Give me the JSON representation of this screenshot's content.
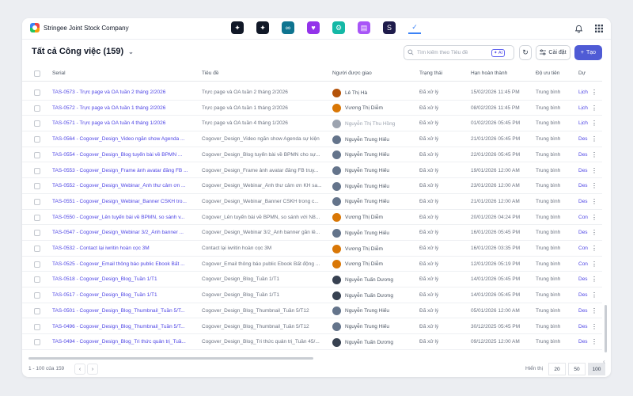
{
  "brand": {
    "name": "Stringee Joint Stock Company"
  },
  "apps": [
    {
      "icon": "grid-app-icon",
      "color": "#111827",
      "glyph": "✦"
    },
    {
      "icon": "grid-app-icon",
      "color": "#111827",
      "glyph": "✦"
    },
    {
      "icon": "link-app-icon",
      "color": "#0e7490",
      "glyph": "∞"
    },
    {
      "icon": "heart-app-icon",
      "color": "#9333ea",
      "glyph": "♥"
    },
    {
      "icon": "gear-app-icon",
      "color": "#14b8a6",
      "glyph": "⚙"
    },
    {
      "icon": "chat-app-icon",
      "color": "#a855f7",
      "glyph": "▤"
    },
    {
      "icon": "s-app-icon",
      "color": "#1e1b4b",
      "glyph": "S"
    },
    {
      "icon": "check-app-icon",
      "color": "#3b82f6",
      "glyph": "✓",
      "active": true
    }
  ],
  "header": {
    "title": "Tất cả Công việc (159)",
    "search_placeholder": "Tìm kiếm theo Tiêu đề",
    "ai_label": "AI",
    "settings_label": "Cài đặt",
    "create_label": "Tạo"
  },
  "columns": {
    "serial": "Serial",
    "title": "Tiêu đề",
    "assignee": "Người được giao",
    "status": "Trạng thái",
    "due": "Hạn hoàn thành",
    "priority": "Độ ưu tiên",
    "project": "Dự"
  },
  "rows": [
    {
      "serial": "TAS-0573 - Trực page và OA tuần 2 tháng 2/2026",
      "title": "Trực page và OA tuần 2 tháng 2/2026",
      "assignee": "Lê Thị Hà",
      "avatar": "#b45309",
      "faded": false,
      "status": "Đã xử lý",
      "due": "15/02/2026 11:45 PM",
      "priority": "Trung bình",
      "project": "Lịch"
    },
    {
      "serial": "TAS-0572 - Trực page và OA tuần 1 tháng 2/2026",
      "title": "Trực page và OA tuần 1 tháng 2/2026",
      "assignee": "Vương Thị Diễm",
      "avatar": "#d97706",
      "faded": false,
      "status": "Đã xử lý",
      "due": "08/02/2026 11:45 PM",
      "priority": "Trung bình",
      "project": "Lịch"
    },
    {
      "serial": "TAS-0571 - Trực page và OA tuần 4 tháng 1/2026",
      "title": "Trực page và OA tuần 4 tháng 1/2026",
      "assignee": "Nguyễn Thị Thu Hồng",
      "avatar": "#9ca3af",
      "faded": true,
      "status": "Đã xử lý",
      "due": "01/02/2026 05:45 PM",
      "priority": "Trung bình",
      "project": "Lịch"
    },
    {
      "serial": "TAS-0564 - Cogover_Design_Video ngắn show Agenda ...",
      "title": "Cogover_Design_Video ngắn show Agenda sự kiện",
      "assignee": "Nguyễn Trung Hiếu",
      "avatar": "#64748b",
      "faded": false,
      "status": "Đã xử lý",
      "due": "21/01/2026 05:45 PM",
      "priority": "Trung bình",
      "project": "Des"
    },
    {
      "serial": "TAS-0554 - Cogover_Design_Blog tuyển bài về BPMN ...",
      "title": "Cogover_Design_Blog tuyển bài về BPMN cho sự...",
      "assignee": "Nguyễn Trung Hiếu",
      "avatar": "#64748b",
      "faded": false,
      "status": "Đã xử lý",
      "due": "22/01/2026 05:45 PM",
      "priority": "Trung bình",
      "project": "Des"
    },
    {
      "serial": "TAS-0553 - Cogover_Design_Frame ảnh avatar đăng FB ...",
      "title": "Cogover_Design_Frame ảnh avatar đăng FB truy...",
      "assignee": "Nguyễn Trung Hiếu",
      "avatar": "#64748b",
      "faded": false,
      "status": "Đã xử lý",
      "due": "19/01/2026 12:00 AM",
      "priority": "Trung bình",
      "project": "Des"
    },
    {
      "serial": "TAS-0552 - Cogover_Design_Webinar_Ảnh thư cảm ơn ...",
      "title": "Cogover_Design_Webinar_Ảnh thư cảm ơn KH sa...",
      "assignee": "Nguyễn Trung Hiếu",
      "avatar": "#64748b",
      "faded": false,
      "status": "Đã xử lý",
      "due": "23/01/2026 12:00 AM",
      "priority": "Trung bình",
      "project": "Des"
    },
    {
      "serial": "TAS-0551 - Cogover_Design_Webinar_Banner CSKH tro...",
      "title": "Cogover_Design_Webinar_Banner CSKH trong c...",
      "assignee": "Nguyễn Trung Hiếu",
      "avatar": "#64748b",
      "faded": false,
      "status": "Đã xử lý",
      "due": "21/01/2026 12:00 AM",
      "priority": "Trung bình",
      "project": "Des"
    },
    {
      "serial": "TAS-0550 - Cogover_Lên tuyển bài về BPMN, so sánh v...",
      "title": "Cogover_Lên tuyển bài về BPMN, so sánh với N8...",
      "assignee": "Vương Thị Diễm",
      "avatar": "#d97706",
      "faded": false,
      "status": "Đã xử lý",
      "due": "20/01/2026 04:24 PM",
      "priority": "Trung bình",
      "project": "Con"
    },
    {
      "serial": "TAS-0547 - Cogover_Design_Webinar 3/2_Ảnh banner ...",
      "title": "Cogover_Design_Webinar 3/2_Ảnh banner gắn lê...",
      "assignee": "Nguyễn Trung Hiếu",
      "avatar": "#64748b",
      "faded": false,
      "status": "Đã xử lý",
      "due": "16/01/2026 05:45 PM",
      "priority": "Trung bình",
      "project": "Des"
    },
    {
      "serial": "TAS-0532 - Contact lại iwritin hoàn cọc 3M",
      "title": "Contact lại iwritin hoàn cọc 3M",
      "assignee": "Vương Thị Diễm",
      "avatar": "#d97706",
      "faded": false,
      "status": "Đã xử lý",
      "due": "16/01/2026 03:35 PM",
      "priority": "Trung bình",
      "project": "Con"
    },
    {
      "serial": "TAS-0525 - Cogover_Email thông báo public Ebook Bất ...",
      "title": "Cogover_Email thông báo public Ebook Bất động ...",
      "assignee": "Vương Thị Diễm",
      "avatar": "#d97706",
      "faded": false,
      "status": "Đã xử lý",
      "due": "12/01/2026 05:19 PM",
      "priority": "Trung bình",
      "project": "Con"
    },
    {
      "serial": "TAS-0518 - Cogover_Design_Blog_Tuần 1/T1",
      "title": "Cogover_Design_Blog_Tuần 1/T1",
      "assignee": "Nguyễn Tuấn Dương",
      "avatar": "#374151",
      "faded": false,
      "status": "Đã xử lý",
      "due": "14/01/2026 05:45 PM",
      "priority": "Trung bình",
      "project": "Des"
    },
    {
      "serial": "TAS-0517 - Cogover_Design_Blog_Tuần 1/T1",
      "title": "Cogover_Design_Blog_Tuần 1/T1",
      "assignee": "Nguyễn Tuấn Dương",
      "avatar": "#374151",
      "faded": false,
      "status": "Đã xử lý",
      "due": "14/01/2026 05:45 PM",
      "priority": "Trung bình",
      "project": "Des"
    },
    {
      "serial": "TAS-0501 - Cogover_Design_Blog_Thumbnail_Tuần 5/T...",
      "title": "Cogover_Design_Blog_Thumbnail_Tuần 5/T12",
      "assignee": "Nguyễn Trung Hiếu",
      "avatar": "#64748b",
      "faded": false,
      "status": "Đã xử lý",
      "due": "05/01/2026 12:00 AM",
      "priority": "Trung bình",
      "project": "Des"
    },
    {
      "serial": "TAS-0496 - Cogover_Design_Blog_Thumbnail_Tuần 5/T...",
      "title": "Cogover_Design_Blog_Thumbnail_Tuần 5/T12",
      "assignee": "Nguyễn Trung Hiếu",
      "avatar": "#64748b",
      "faded": false,
      "status": "Đã xử lý",
      "due": "30/12/2025 05:45 PM",
      "priority": "Trung bình",
      "project": "Des"
    },
    {
      "serial": "TAS-0494 - Cogover_Design_Blog_Tri thức quản trị_Tuầ...",
      "title": "Cogover_Design_Blog_Tri thức quản trị_Tuần 45/...",
      "assignee": "Nguyễn Tuấn Dương",
      "avatar": "#374151",
      "faded": false,
      "status": "Đã xử lý",
      "due": "09/12/2025 12:00 AM",
      "priority": "Trung bình",
      "project": "Des"
    }
  ],
  "footer": {
    "range": "1 - 100 của 159",
    "prev": "‹",
    "next": "›",
    "show_label": "Hiển thị",
    "sizes": [
      "20",
      "50",
      "100"
    ],
    "selected_size": "100"
  }
}
